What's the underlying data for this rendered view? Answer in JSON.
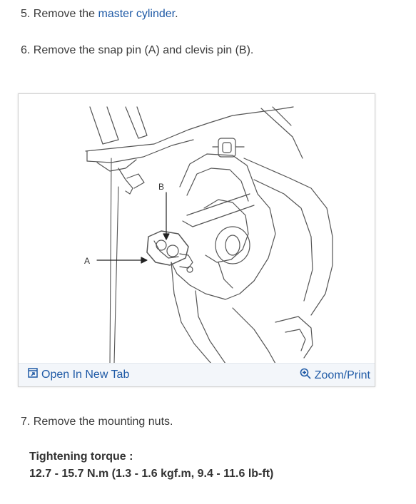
{
  "steps": {
    "step5": {
      "prefix": "5. Remove the ",
      "link": "master cylinder",
      "suffix": "."
    },
    "step6": {
      "text": "6. Remove the snap pin (A) and clevis pin (B)."
    },
    "step7": {
      "text": "7. Remove the mounting nuts."
    }
  },
  "figure": {
    "label_a": "A",
    "label_b": "B",
    "open_tab": {
      "icon": "open-new-tab-icon",
      "label": "Open In New Tab"
    },
    "zoom": {
      "icon": "zoom-icon",
      "label": "Zoom/Print"
    }
  },
  "torque": {
    "title": "Tightening torque :",
    "value": "12.7 - 15.7 N.m (1.3 - 1.6 kgf.m, 9.4 - 11.6 lb-ft)"
  },
  "colors": {
    "link": "#1f5aa6",
    "bar": "#f3f6fa"
  }
}
